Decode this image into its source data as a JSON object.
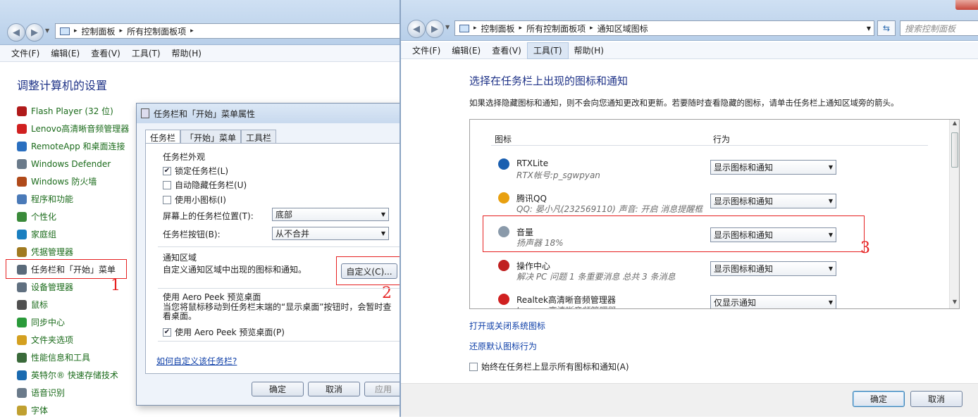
{
  "left_window": {
    "breadcrumb": [
      "控制面板",
      "所有控制面板项"
    ],
    "menu": [
      "文件(F)",
      "编辑(E)",
      "查看(V)",
      "工具(T)",
      "帮助(H)"
    ],
    "heading": "调整计算机的设置",
    "items": [
      {
        "label": "Flash Player (32 位)",
        "icon": "flash-icon",
        "color": "#b01a1a"
      },
      {
        "label": "Lenovo高清晰音频管理器",
        "icon": "audio-icon",
        "color": "#d02020"
      },
      {
        "label": "RemoteApp 和桌面连接",
        "icon": "remote-icon",
        "color": "#2a6fc0"
      },
      {
        "label": "Windows Defender",
        "icon": "defender-icon",
        "color": "#6a7a8a"
      },
      {
        "label": "Windows 防火墙",
        "icon": "firewall-icon",
        "color": "#b04a1a"
      },
      {
        "label": "程序和功能",
        "icon": "programs-icon",
        "color": "#4a7ab8"
      },
      {
        "label": "个性化",
        "icon": "personalize-icon",
        "color": "#3a8a3a"
      },
      {
        "label": "家庭组",
        "icon": "homegroup-icon",
        "color": "#1a7fc0"
      },
      {
        "label": "凭据管理器",
        "icon": "credential-icon",
        "color": "#a07a20"
      },
      {
        "label": "任务栏和「开始」菜单",
        "icon": "taskbar-icon",
        "color": "#5a6a7a"
      },
      {
        "label": "设备管理器",
        "icon": "device-icon",
        "color": "#607080"
      },
      {
        "label": "鼠标",
        "icon": "mouse-icon",
        "color": "#505050"
      },
      {
        "label": "同步中心",
        "icon": "sync-icon",
        "color": "#2a9a3a"
      },
      {
        "label": "文件夹选项",
        "icon": "folder-icon",
        "color": "#d4a020"
      },
      {
        "label": "性能信息和工具",
        "icon": "performance-icon",
        "color": "#3a6a3a"
      },
      {
        "label": "英特尔® 快速存储技术",
        "icon": "intel-icon",
        "color": "#1a6ab0"
      },
      {
        "label": "语音识别",
        "icon": "speech-icon",
        "color": "#6a7a8a"
      },
      {
        "label": "字体",
        "icon": "font-icon",
        "color": "#c0a030"
      }
    ],
    "annotation_1": "1"
  },
  "dialog": {
    "title": "任务栏和「开始」菜单属性",
    "tabs": [
      "任务栏",
      "「开始」菜单",
      "工具栏"
    ],
    "appearance_group": "任务栏外观",
    "lock_taskbar": "锁定任务栏(L)",
    "autohide": "自动隐藏任务栏(U)",
    "small_icons": "使用小图标(I)",
    "location_label": "屏幕上的任务栏位置(T):",
    "location_value": "底部",
    "buttons_label": "任务栏按钮(B):",
    "buttons_value": "从不合并",
    "notify_group": "通知区域",
    "notify_text": "自定义通知区域中出现的图标和通知。",
    "customize_button": "自定义(C)...",
    "aero_group": "使用 Aero Peek 预览桌面",
    "aero_text": "当您将鼠标移动到任务栏末端的“显示桌面”按钮时，会暂时查看桌面。",
    "aero_check": "使用 Aero Peek 预览桌面(P)",
    "help_link": "如何自定义该任务栏?",
    "ok": "确定",
    "cancel": "取消",
    "apply": "应用",
    "annotation_2": "2"
  },
  "right_window": {
    "breadcrumb": [
      "控制面板",
      "所有控制面板项",
      "通知区域图标"
    ],
    "search_placeholder": "搜索控制面板",
    "menu": [
      "文件(F)",
      "编辑(E)",
      "查看(V)",
      "工具(T)",
      "帮助(H)"
    ],
    "heading": "选择在任务栏上出现的图标和通知",
    "description": "如果选择隐藏图标和通知，则不会向您通知更改和更新。若要随时查看隐藏的图标，请单击任务栏上通知区域旁的箭头。",
    "col_icon": "图标",
    "col_behavior": "行为",
    "rows": [
      {
        "name": "RTXLite",
        "sub": "RTX帐号:p_sgwpyan",
        "behavior": "显示图标和通知",
        "icon": "rtx-icon",
        "color": "#1a5fb0"
      },
      {
        "name": "腾讯QQ",
        "sub": "QQ: 晏小凡(232569110)  声音: 开启  消息提醒框...",
        "behavior": "显示图标和通知",
        "icon": "qq-icon",
        "color": "#e8a010"
      },
      {
        "name": "音量",
        "sub": "扬声器 18%",
        "behavior": "显示图标和通知",
        "icon": "volume-icon",
        "color": "#8a9aaa"
      },
      {
        "name": "操作中心",
        "sub": "解决 PC 问题 1 条重要消息  总共 3 条消息",
        "behavior": "显示图标和通知",
        "icon": "action-center-icon",
        "color": "#c02020"
      },
      {
        "name": "Realtek高清晰音频管理器",
        "sub": "Lenovo高清晰音频管理器",
        "behavior": "仅显示通知",
        "icon": "realtek-icon",
        "color": "#d02020"
      }
    ],
    "link_system_icons": "打开或关闭系统图标",
    "link_restore": "还原默认图标行为",
    "always_show": "始终在任务栏上显示所有图标和通知(A)",
    "ok": "确定",
    "cancel": "取消",
    "annotation_3": "3"
  }
}
